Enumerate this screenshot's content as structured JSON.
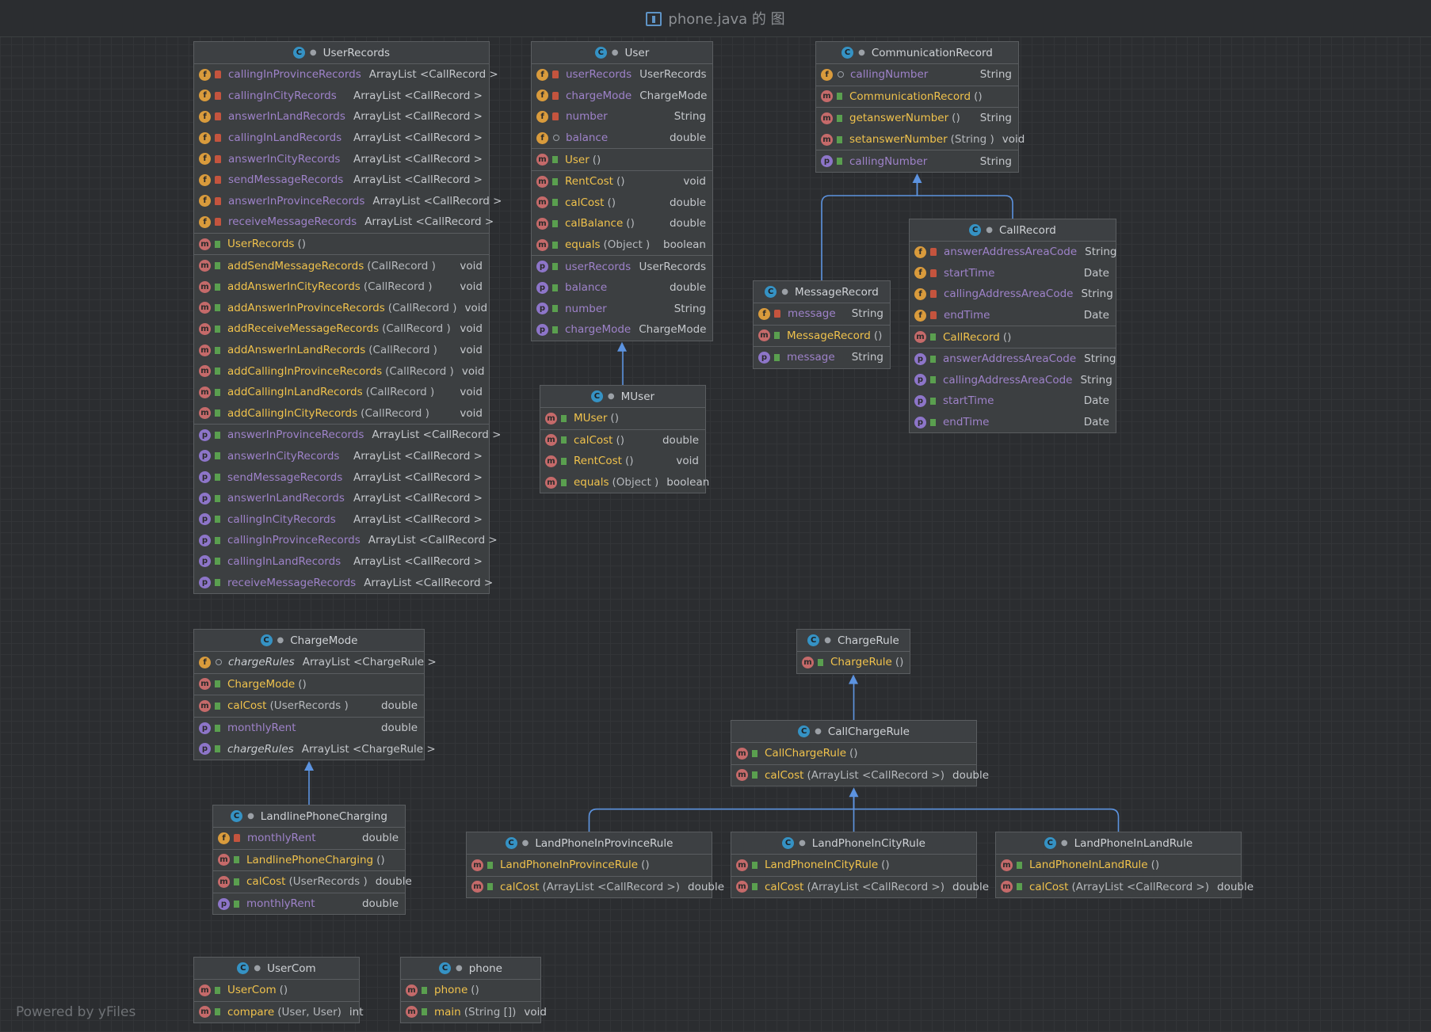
{
  "title": "phone.java 的 图",
  "watermark": "Powered by yFiles",
  "colors": {
    "background": "#2b2d30",
    "node": "#3c3f41",
    "edge": "#5c93e0",
    "field": "#9e82c9",
    "method": "#f0c24c"
  },
  "nodes": [
    {
      "id": "UserRecords",
      "name": "UserRecords",
      "icon": "class-icon",
      "sections": [
        [
          {
            "kind": "f",
            "vis": "private",
            "name": "callingInProvinceRecords",
            "type": "ArrayList <CallRecord >"
          },
          {
            "kind": "f",
            "vis": "private",
            "name": "callingInCityRecords",
            "type": "ArrayList <CallRecord >"
          },
          {
            "kind": "f",
            "vis": "private",
            "name": "answerInLandRecords",
            "type": "ArrayList <CallRecord >"
          },
          {
            "kind": "f",
            "vis": "private",
            "name": "callingInLandRecords",
            "type": "ArrayList <CallRecord >"
          },
          {
            "kind": "f",
            "vis": "private",
            "name": "answerInCityRecords",
            "type": "ArrayList <CallRecord >"
          },
          {
            "kind": "f",
            "vis": "private",
            "name": "sendMessageRecords",
            "type": "ArrayList <CallRecord >"
          },
          {
            "kind": "f",
            "vis": "private",
            "name": "answerInProvinceRecords",
            "type": "ArrayList <CallRecord >"
          },
          {
            "kind": "f",
            "vis": "private",
            "name": "receiveMessageRecords",
            "type": "ArrayList <CallRecord >"
          }
        ],
        [
          {
            "kind": "m",
            "vis": "public",
            "name": "UserRecords",
            "params": "()",
            "type": ""
          }
        ],
        [
          {
            "kind": "m",
            "vis": "public",
            "name": "addSendMessageRecords",
            "params": "(CallRecord )",
            "type": "void"
          },
          {
            "kind": "m",
            "vis": "public",
            "name": "addAnswerInCityRecords",
            "params": "(CallRecord )",
            "type": "void"
          },
          {
            "kind": "m",
            "vis": "public",
            "name": "addAnswerInProvinceRecords",
            "params": "(CallRecord )",
            "type": "void"
          },
          {
            "kind": "m",
            "vis": "public",
            "name": "addReceiveMessageRecords",
            "params": "(CallRecord )",
            "type": "void"
          },
          {
            "kind": "m",
            "vis": "public",
            "name": "addAnswerInLandRecords",
            "params": "(CallRecord )",
            "type": "void"
          },
          {
            "kind": "m",
            "vis": "public",
            "name": "addCallingInProvinceRecords",
            "params": "(CallRecord )",
            "type": "void"
          },
          {
            "kind": "m",
            "vis": "public",
            "name": "addCallingInLandRecords",
            "params": "(CallRecord )",
            "type": "void"
          },
          {
            "kind": "m",
            "vis": "public",
            "name": "addCallingInCityRecords",
            "params": "(CallRecord )",
            "type": "void"
          }
        ],
        [
          {
            "kind": "p",
            "vis": "public",
            "name": "answerInProvinceRecords",
            "type": "ArrayList <CallRecord >"
          },
          {
            "kind": "p",
            "vis": "public",
            "name": "answerInCityRecords",
            "type": "ArrayList <CallRecord >"
          },
          {
            "kind": "p",
            "vis": "public",
            "name": "sendMessageRecords",
            "type": "ArrayList <CallRecord >"
          },
          {
            "kind": "p",
            "vis": "public",
            "name": "answerInLandRecords",
            "type": "ArrayList <CallRecord >"
          },
          {
            "kind": "p",
            "vis": "public",
            "name": "callingInCityRecords",
            "type": "ArrayList <CallRecord >"
          },
          {
            "kind": "p",
            "vis": "public",
            "name": "callingInProvinceRecords",
            "type": "ArrayList <CallRecord >"
          },
          {
            "kind": "p",
            "vis": "public",
            "name": "callingInLandRecords",
            "type": "ArrayList <CallRecord >"
          },
          {
            "kind": "p",
            "vis": "public",
            "name": "receiveMessageRecords",
            "type": "ArrayList <CallRecord >"
          }
        ]
      ]
    },
    {
      "id": "User",
      "name": "User",
      "icon": "class-icon",
      "sections": [
        [
          {
            "kind": "f",
            "vis": "private",
            "name": "userRecords",
            "type": "UserRecords"
          },
          {
            "kind": "f",
            "vis": "private",
            "name": "chargeMode",
            "type": "ChargeMode"
          },
          {
            "kind": "f",
            "vis": "private",
            "name": "number",
            "type": "String"
          },
          {
            "kind": "f",
            "vis": "package",
            "name": "balance",
            "type": "double"
          }
        ],
        [
          {
            "kind": "m",
            "vis": "public",
            "name": "User",
            "params": "()",
            "type": ""
          }
        ],
        [
          {
            "kind": "m",
            "vis": "public",
            "name": "RentCost",
            "params": "()",
            "type": "void"
          },
          {
            "kind": "m",
            "vis": "public",
            "name": "calCost",
            "params": "()",
            "type": "double"
          },
          {
            "kind": "m",
            "vis": "public",
            "name": "calBalance",
            "params": "()",
            "type": "double"
          },
          {
            "kind": "m",
            "vis": "public",
            "name": "equals",
            "params": "(Object )",
            "type": "boolean"
          }
        ],
        [
          {
            "kind": "p",
            "vis": "public",
            "name": "userRecords",
            "type": "UserRecords"
          },
          {
            "kind": "p",
            "vis": "public",
            "name": "balance",
            "type": "double"
          },
          {
            "kind": "p",
            "vis": "public",
            "name": "number",
            "type": "String"
          },
          {
            "kind": "p",
            "vis": "public",
            "name": "chargeMode",
            "type": "ChargeMode"
          }
        ]
      ]
    },
    {
      "id": "MUser",
      "name": "MUser",
      "icon": "class-icon",
      "sections": [
        [
          {
            "kind": "m",
            "vis": "public",
            "name": "MUser",
            "params": "()",
            "type": ""
          }
        ],
        [
          {
            "kind": "m",
            "vis": "public",
            "name": "calCost",
            "params": "()",
            "type": "double"
          },
          {
            "kind": "m",
            "vis": "public",
            "name": "RentCost",
            "params": "()",
            "type": "void"
          },
          {
            "kind": "m",
            "vis": "public",
            "name": "equals",
            "params": "(Object )",
            "type": "boolean"
          }
        ]
      ]
    },
    {
      "id": "CommunicationRecord",
      "name": "CommunicationRecord",
      "icon": "abstract-class-icon",
      "sections": [
        [
          {
            "kind": "f",
            "vis": "package",
            "name": "callingNumber",
            "type": "String"
          }
        ],
        [
          {
            "kind": "m",
            "vis": "public",
            "name": "CommunicationRecord",
            "params": "()",
            "type": ""
          }
        ],
        [
          {
            "kind": "m",
            "vis": "public",
            "name": "getanswerNumber",
            "params": "()",
            "type": "String"
          },
          {
            "kind": "m",
            "vis": "public",
            "name": "setanswerNumber",
            "params": "(String )",
            "type": "void"
          }
        ],
        [
          {
            "kind": "p",
            "vis": "public",
            "name": "callingNumber",
            "type": "String"
          }
        ]
      ]
    },
    {
      "id": "CallRecord",
      "name": "CallRecord",
      "icon": "class-icon",
      "sections": [
        [
          {
            "kind": "f",
            "vis": "private",
            "name": "answerAddressAreaCode",
            "type": "String"
          },
          {
            "kind": "f",
            "vis": "private",
            "name": "startTime",
            "type": "Date"
          },
          {
            "kind": "f",
            "vis": "private",
            "name": "callingAddressAreaCode",
            "type": "String"
          },
          {
            "kind": "f",
            "vis": "private",
            "name": "endTime",
            "type": "Date"
          }
        ],
        [
          {
            "kind": "m",
            "vis": "public",
            "name": "CallRecord",
            "params": "()",
            "type": ""
          }
        ],
        [
          {
            "kind": "p",
            "vis": "public",
            "name": "answerAddressAreaCode",
            "type": "String"
          },
          {
            "kind": "p",
            "vis": "public",
            "name": "callingAddressAreaCode",
            "type": "String"
          },
          {
            "kind": "p",
            "vis": "public",
            "name": "startTime",
            "type": "Date"
          },
          {
            "kind": "p",
            "vis": "public",
            "name": "endTime",
            "type": "Date"
          }
        ]
      ]
    },
    {
      "id": "MessageRecord",
      "name": "MessageRecord",
      "icon": "class-icon",
      "sections": [
        [
          {
            "kind": "f",
            "vis": "private",
            "name": "message",
            "type": "String"
          }
        ],
        [
          {
            "kind": "m",
            "vis": "public",
            "name": "MessageRecord",
            "params": "()",
            "type": ""
          }
        ],
        [
          {
            "kind": "p",
            "vis": "public",
            "name": "message",
            "type": "String"
          }
        ]
      ]
    },
    {
      "id": "ChargeMode",
      "name": "ChargeMode",
      "icon": "abstract-class-icon",
      "sections": [
        [
          {
            "kind": "f",
            "vis": "package",
            "name": "chargeRules",
            "type": "ArrayList <ChargeRule >",
            "italic": true
          }
        ],
        [
          {
            "kind": "m",
            "vis": "public",
            "name": "ChargeMode",
            "params": "()",
            "type": ""
          }
        ],
        [
          {
            "kind": "m",
            "vis": "public",
            "name": "calCost",
            "params": "(UserRecords )",
            "type": "double"
          }
        ],
        [
          {
            "kind": "p",
            "vis": "public",
            "name": "monthlyRent",
            "type": "double"
          },
          {
            "kind": "p",
            "vis": "public",
            "name": "chargeRules",
            "type": "ArrayList <ChargeRule >",
            "italic": true
          }
        ]
      ]
    },
    {
      "id": "LandlinePhoneCharging",
      "name": "LandlinePhoneCharging",
      "icon": "class-icon",
      "sections": [
        [
          {
            "kind": "f",
            "vis": "private",
            "name": "monthlyRent",
            "type": "double"
          }
        ],
        [
          {
            "kind": "m",
            "vis": "public",
            "name": "LandlinePhoneCharging",
            "params": "()",
            "type": ""
          }
        ],
        [
          {
            "kind": "m",
            "vis": "public",
            "name": "calCost",
            "params": "(UserRecords )",
            "type": "double"
          }
        ],
        [
          {
            "kind": "p",
            "vis": "public",
            "name": "monthlyRent",
            "type": "double"
          }
        ]
      ]
    },
    {
      "id": "ChargeRule",
      "name": "ChargeRule",
      "icon": "abstract-class-icon",
      "sections": [
        [
          {
            "kind": "m",
            "vis": "public",
            "name": "ChargeRule",
            "params": "()",
            "type": ""
          }
        ]
      ]
    },
    {
      "id": "CallChargeRule",
      "name": "CallChargeRule",
      "icon": "abstract-class-icon",
      "sections": [
        [
          {
            "kind": "m",
            "vis": "public",
            "name": "CallChargeRule",
            "params": "()",
            "type": ""
          }
        ],
        [
          {
            "kind": "m",
            "vis": "public",
            "name": "calCost",
            "params": "(ArrayList <CallRecord >)",
            "type": "double"
          }
        ]
      ]
    },
    {
      "id": "LandPhoneInProvinceRule",
      "name": "LandPhoneInProvinceRule",
      "icon": "class-icon",
      "sections": [
        [
          {
            "kind": "m",
            "vis": "public",
            "name": "LandPhoneInProvinceRule",
            "params": "()",
            "type": ""
          }
        ],
        [
          {
            "kind": "m",
            "vis": "public",
            "name": "calCost",
            "params": "(ArrayList <CallRecord >)",
            "type": "double"
          }
        ]
      ]
    },
    {
      "id": "LandPhoneInCityRule",
      "name": "LandPhoneInCityRule",
      "icon": "class-icon",
      "sections": [
        [
          {
            "kind": "m",
            "vis": "public",
            "name": "LandPhoneInCityRule",
            "params": "()",
            "type": ""
          }
        ],
        [
          {
            "kind": "m",
            "vis": "public",
            "name": "calCost",
            "params": "(ArrayList <CallRecord >)",
            "type": "double"
          }
        ]
      ]
    },
    {
      "id": "LandPhoneInLandRule",
      "name": "LandPhoneInLandRule",
      "icon": "class-icon",
      "sections": [
        [
          {
            "kind": "m",
            "vis": "public",
            "name": "LandPhoneInLandRule",
            "params": "()",
            "type": ""
          }
        ],
        [
          {
            "kind": "m",
            "vis": "public",
            "name": "calCost",
            "params": "(ArrayList <CallRecord >)",
            "type": "double"
          }
        ]
      ]
    },
    {
      "id": "UserCom",
      "name": "UserCom",
      "icon": "class-icon",
      "sections": [
        [
          {
            "kind": "m",
            "vis": "public",
            "name": "UserCom",
            "params": "()",
            "type": ""
          }
        ],
        [
          {
            "kind": "m",
            "vis": "public",
            "name": "compare",
            "params": "(User, User)",
            "type": "int"
          }
        ]
      ]
    },
    {
      "id": "phone",
      "name": "phone",
      "icon": "main-class-icon",
      "sections": [
        [
          {
            "kind": "m",
            "vis": "public",
            "name": "phone",
            "params": "()",
            "type": ""
          }
        ],
        [
          {
            "kind": "m",
            "vis": "public",
            "name": "main",
            "params": "(String [])",
            "type": "void"
          }
        ]
      ]
    }
  ],
  "edges": [
    {
      "from": "MUser",
      "to": "User"
    },
    {
      "from": "MessageRecord",
      "to": "CommunicationRecord"
    },
    {
      "from": "CallRecord",
      "to": "CommunicationRecord"
    },
    {
      "from": "LandlinePhoneCharging",
      "to": "ChargeMode"
    },
    {
      "from": "CallChargeRule",
      "to": "ChargeRule"
    },
    {
      "from": "LandPhoneInProvinceRule",
      "to": "CallChargeRule"
    },
    {
      "from": "LandPhoneInCityRule",
      "to": "CallChargeRule"
    },
    {
      "from": "LandPhoneInLandRule",
      "to": "CallChargeRule"
    }
  ]
}
